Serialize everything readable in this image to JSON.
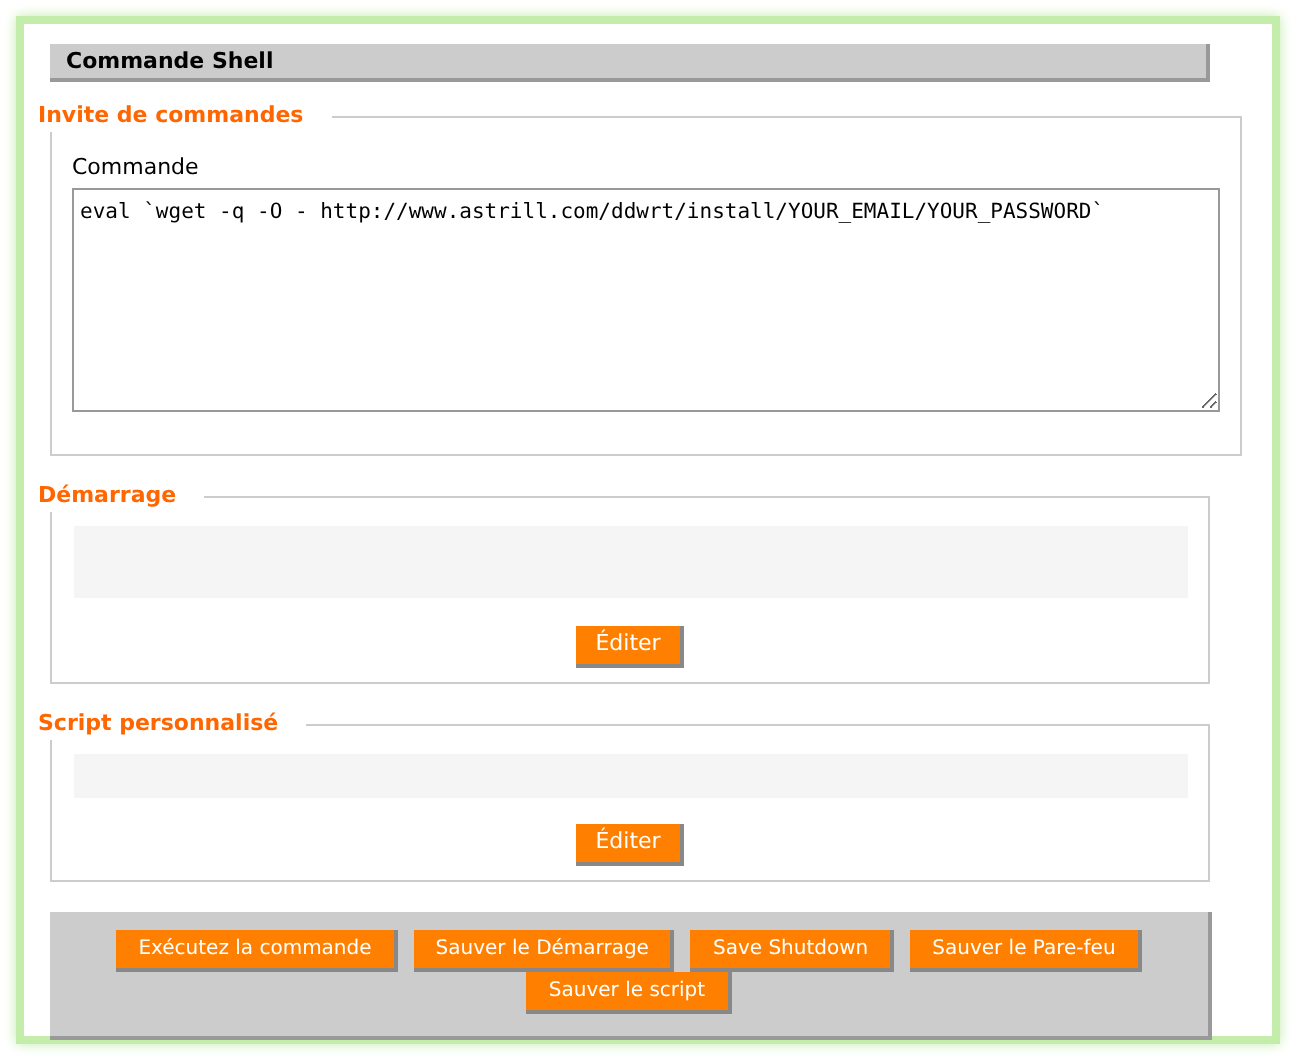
{
  "title": "Commande Shell",
  "sections": [
    {
      "kind": "command",
      "legend": "Invite de commandes",
      "label": "Commande",
      "value": "eval `wget -q -O - http://www.astrill.com/ddwrt/install/YOUR_EMAIL/YOUR_PASSWORD`"
    },
    {
      "kind": "script",
      "legend": "Démarrage",
      "button": "Éditer"
    },
    {
      "kind": "script",
      "legend": "Script personnalisé",
      "button": "Éditer"
    }
  ],
  "actions": [
    "Exécutez la commande",
    "Sauver le Démarrage",
    "Save Shutdown",
    "Sauver le Pare-feu",
    "Sauver le script"
  ]
}
